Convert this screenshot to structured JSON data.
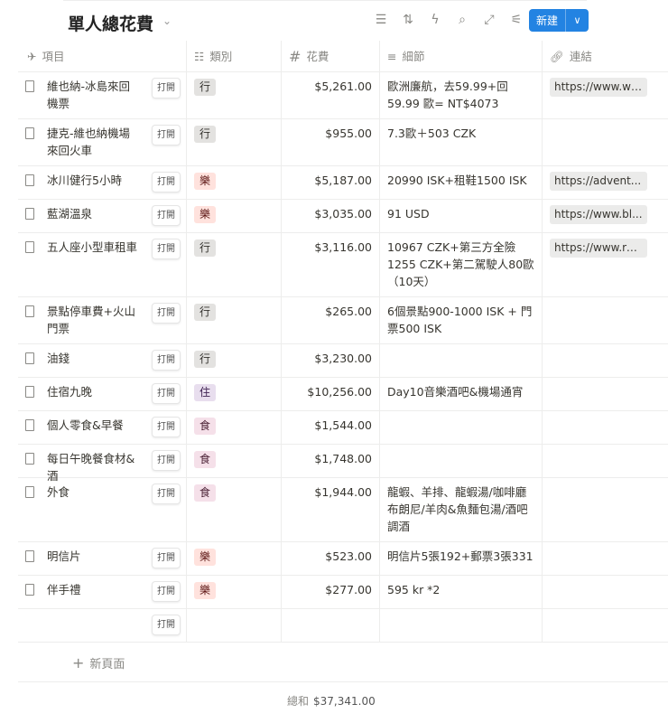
{
  "title": "單人總花費",
  "new_button": "新建",
  "columns": {
    "item": "項目",
    "category": "類別",
    "cost": "花費",
    "details": "細節",
    "link": "連結"
  },
  "open_label": "打開",
  "tag_colors": {
    "行": {
      "bg": "#e3e2e0",
      "fg": "#32302c"
    },
    "樂": {
      "bg": "#ffe2dd",
      "fg": "#5d1715"
    },
    "住": {
      "bg": "#e8deee",
      "fg": "#412454"
    },
    "食": {
      "bg": "#f5e0e9",
      "fg": "#4c2337"
    }
  },
  "rows": [
    {
      "name": "維也納-冰島來回機票",
      "category": "行",
      "cost": "$5,261.00",
      "details": "歐洲廉航，去59.99+回59.99 歐= NT$4073",
      "link": "https://www.wi..."
    },
    {
      "name": "捷克-維也納機場來回火車",
      "category": "行",
      "cost": "$955.00",
      "details": "7.3歐＋503 CZK",
      "link": ""
    },
    {
      "name": "冰川健行5小時",
      "category": "樂",
      "cost": "$5,187.00",
      "details": "20990 ISK+租鞋1500 ISK",
      "link": "https://advent..."
    },
    {
      "name": "藍湖溫泉",
      "category": "樂",
      "cost": "$3,035.00",
      "details": "91 USD",
      "link": "https://www.bl..."
    },
    {
      "name": "五人座小型車租車",
      "category": "行",
      "cost": "$3,116.00",
      "details": "10967 CZK+第三方全險1255 CZK+第二駕駛人80歐（10天）",
      "link": "https://www.re..."
    },
    {
      "name": "景點停車費+火山門票",
      "category": "行",
      "cost": "$265.00",
      "details": "6個景點900-1000 ISK + 門票500 ISK",
      "link": ""
    },
    {
      "name": "油錢",
      "category": "行",
      "cost": "$3,230.00",
      "details": "",
      "link": ""
    },
    {
      "name": "住宿九晚",
      "category": "住",
      "cost": "$10,256.00",
      "details": "Day10音樂酒吧&機場通宵",
      "link": ""
    },
    {
      "name": "個人零食&早餐",
      "category": "食",
      "cost": "$1,544.00",
      "details": "",
      "link": ""
    },
    {
      "name": "每日午晚餐食材&酒",
      "category": "食",
      "cost": "$1,748.00",
      "details": "",
      "link": ""
    },
    {
      "name": "外食",
      "category": "食",
      "cost": "$1,944.00",
      "details": "龍蝦、羊排、龍蝦湯/咖啡廳布朗尼/羊肉&魚麵包湯/酒吧調酒",
      "link": ""
    },
    {
      "name": "明信片",
      "category": "樂",
      "cost": "$523.00",
      "details": "明信片5張192+郵票3張331",
      "link": ""
    },
    {
      "name": "伴手禮",
      "category": "樂",
      "cost": "$277.00",
      "details": "595 kr *2",
      "link": ""
    },
    {
      "name": "",
      "category": "",
      "cost": "",
      "details": "",
      "link": ""
    }
  ],
  "new_page": "新頁面",
  "sum_label": "總和",
  "sum_value": "$37,341.00"
}
